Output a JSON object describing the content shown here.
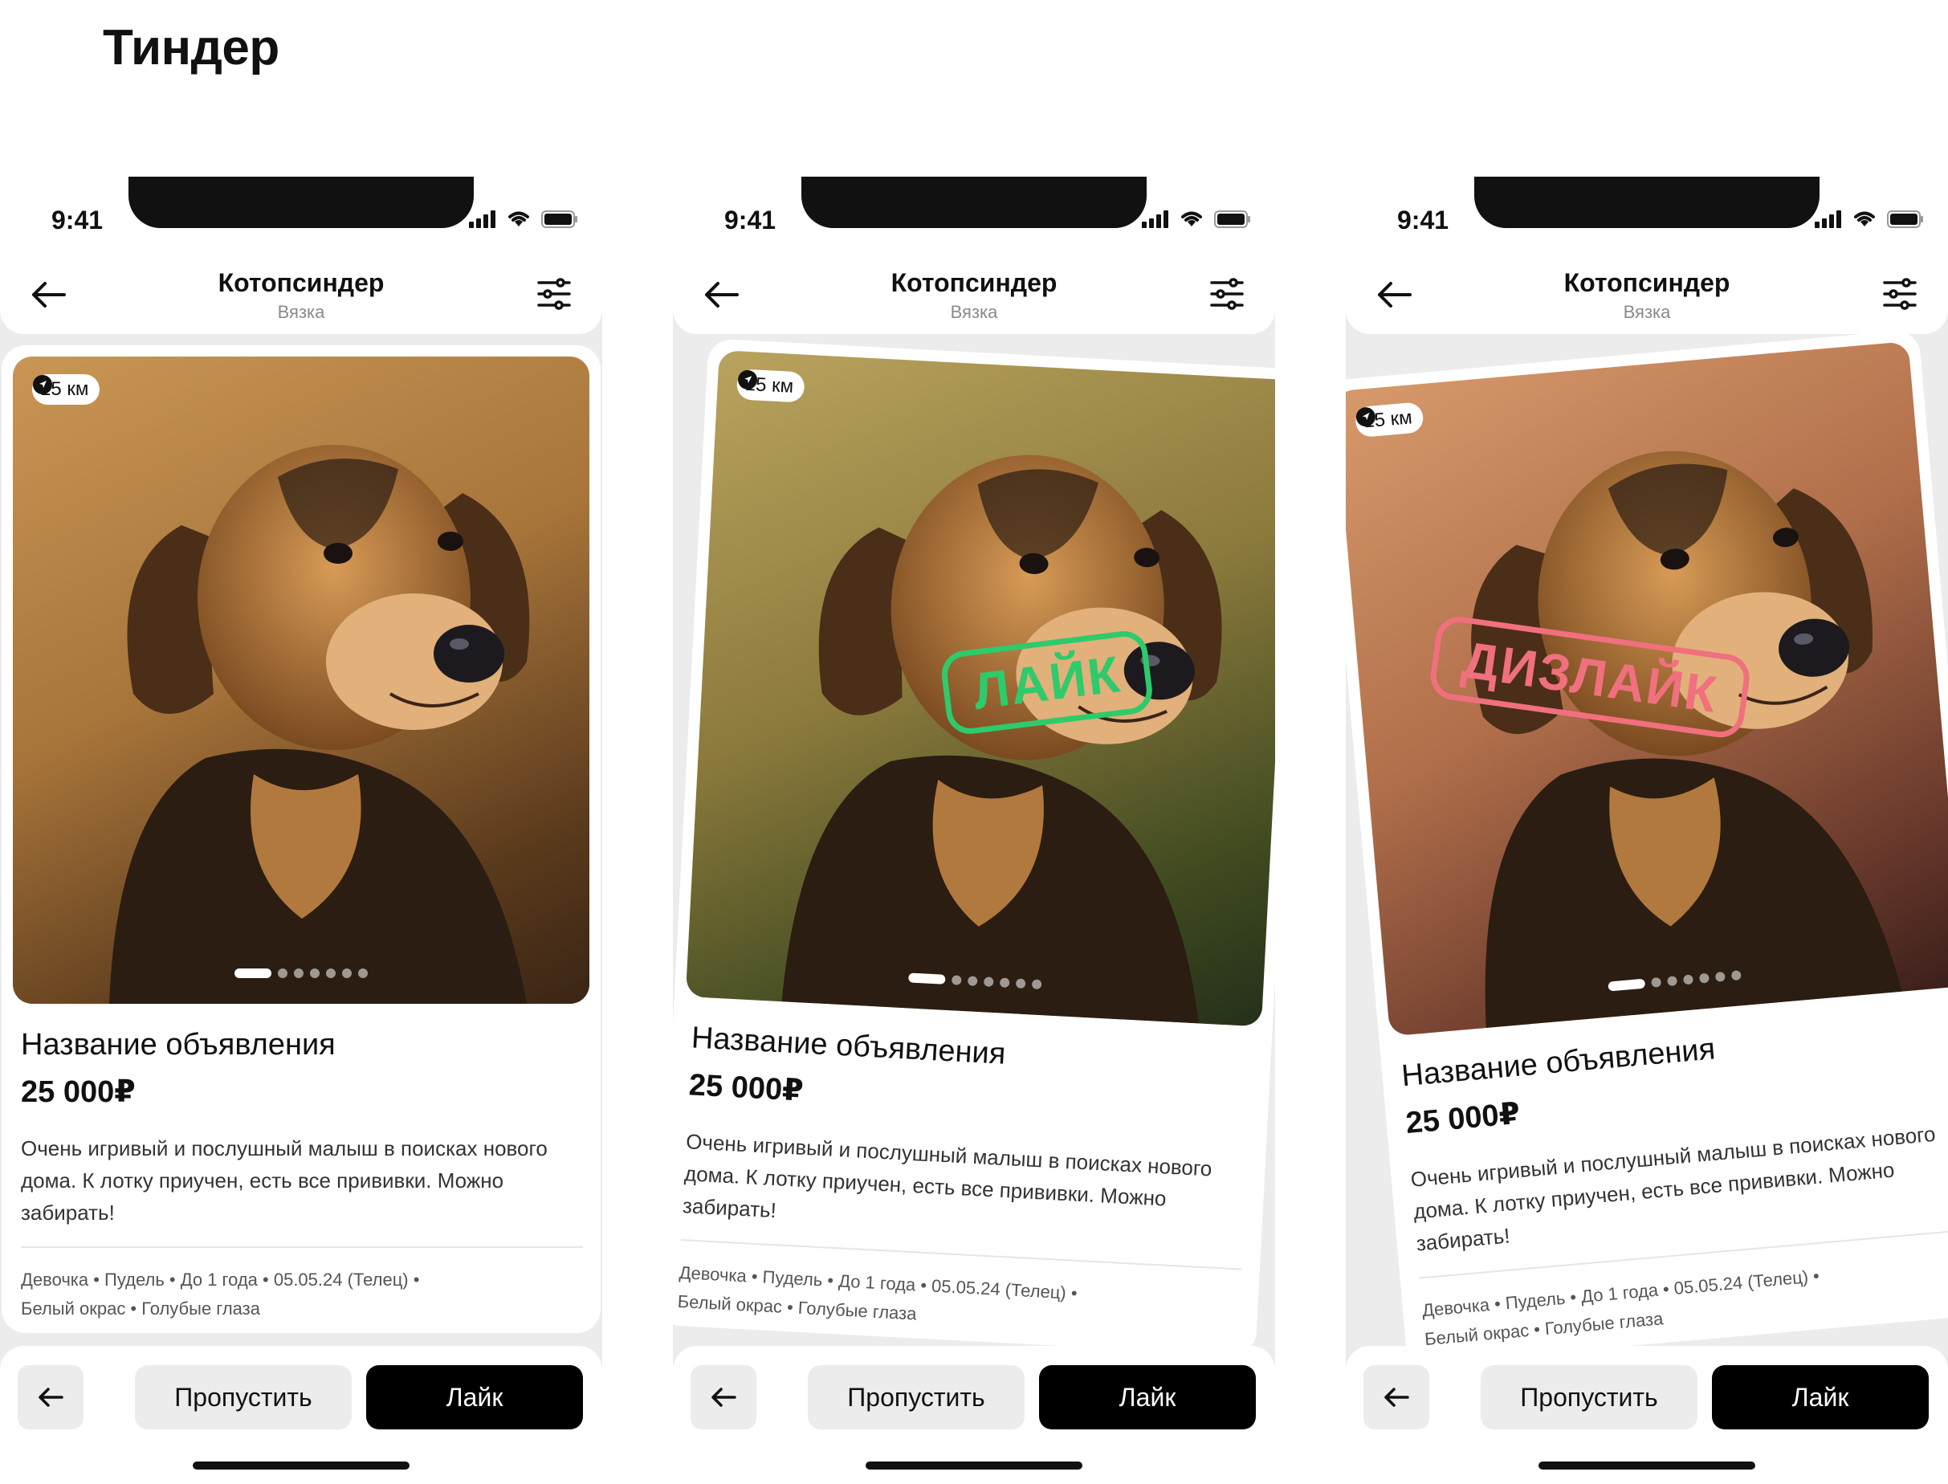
{
  "page_title": "Тиндер",
  "phones": [
    {
      "time": "9:41",
      "header": {
        "title": "Котопсиндер",
        "subtitle": "Вязка"
      },
      "card": {
        "distance": "15 км",
        "title": "Название объявления",
        "price": "25 000₽",
        "description": "Очень игривый и послушный малыш в поисках нового дома. К лотку приучен, есть все прививки. Можно забирать!",
        "tags_line1": "Девочка • Пудель • До 1 года • 05.05.24 (Телец) •",
        "tags_line2": "Белый окрас • Голубые глаза",
        "stamp": ""
      },
      "buttons": {
        "skip": "Пропустить",
        "like": "Лайк"
      }
    },
    {
      "time": "9:41",
      "header": {
        "title": "Котопсиндер",
        "subtitle": "Вязка"
      },
      "card": {
        "distance": "15 км",
        "title": "Название объявления",
        "price": "25 000₽",
        "description": "Очень игривый и послушный малыш в поисках нового дома. К лотку приучен, есть все прививки. Можно забирать!",
        "tags_line1": "Девочка • Пудель • До 1 года • 05.05.24 (Телец) •",
        "tags_line2": "Белый окрас • Голубые глаза",
        "stamp": "ЛАЙК"
      },
      "buttons": {
        "skip": "Пропустить",
        "like": "Лайк"
      }
    },
    {
      "time": "9:41",
      "header": {
        "title": "Котопсиндер",
        "subtitle": "Вязка"
      },
      "card": {
        "distance": "15 км",
        "title": "Название объявления",
        "price": "25 000₽",
        "description": "Очень игривый и послушный малыш в поисках нового дома. К лотку приучен, есть все прививки. Можно забирать!",
        "tags_line1": "Девочка • Пудель • До 1 года • 05.05.24 (Телец) •",
        "tags_line2": "Белый окрас • Голубые глаза",
        "stamp": "ДИЗЛАЙК"
      },
      "buttons": {
        "skip": "Пропустить",
        "like": "Лайк"
      }
    }
  ]
}
